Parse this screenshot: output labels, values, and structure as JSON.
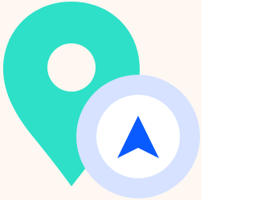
{
  "icon": {
    "name": "location-navigation-icon",
    "parts": {
      "pin": "map-pin-icon",
      "navigation": "navigation-arrow-icon"
    }
  },
  "colors": {
    "background": "#FFF8F2",
    "pin": "#2EE0C8",
    "pin_hole": "#FFF8F2",
    "badge_outer": "#D6E2FF",
    "badge_inner": "#FFFFFF",
    "arrow": "#0A5BFF"
  }
}
